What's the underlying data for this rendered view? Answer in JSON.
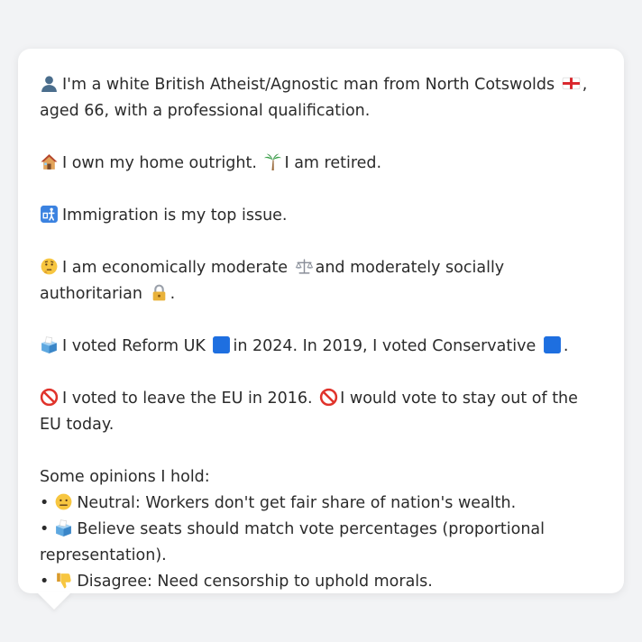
{
  "profile": {
    "intro": {
      "icon": "person-silhouette-icon",
      "text_a": "I'm a white British Atheist/Agnostic man from North Cotswolds",
      "flag_icon": "england-flag-icon",
      "text_b": ", aged 66, with a professional qualification."
    },
    "housing": {
      "icon": "house-icon",
      "text_a": "I own my home outright.",
      "palm_icon": "palm-tree-icon",
      "text_b": "I am retired."
    },
    "issue": {
      "icon": "passport-control-icon",
      "text": "Immigration is my top issue."
    },
    "ideology": {
      "icon": "thinking-face-icon",
      "text_a": "I am economically moderate",
      "scale_icon": "balance-scale-icon",
      "text_b": "and moderately socially authoritarian",
      "lock_icon": "padlock-icon",
      "text_c": "."
    },
    "votes": {
      "icon": "ballot-box-icon",
      "text_a": "I voted Reform UK",
      "reform_icon": "blue-square-icon",
      "text_b": "in 2024. In 2019, I voted Conservative",
      "con_icon": "blue-square-icon",
      "text_c": "."
    },
    "eu": {
      "icon": "prohibited-icon",
      "text_a": "I voted to leave the EU in 2016.",
      "icon_b": "prohibited-icon",
      "text_b": "I would vote to stay out of the EU today."
    },
    "opinions": {
      "heading": "Some opinions I hold:",
      "items": [
        {
          "icon": "neutral-face-icon",
          "text": "Neutral: Workers don't get fair share of nation's wealth."
        },
        {
          "icon": "ballot-box-icon",
          "text": "Believe seats should match vote percentages (proportional representation)."
        },
        {
          "icon": "thumbs-down-icon",
          "text": "Disagree: Need censorship to uphold morals."
        }
      ]
    }
  },
  "colors": {
    "background": "#f2f3f5",
    "bubble": "#ffffff",
    "text": "#2b2b2b",
    "party_blue": "#1e6fe0"
  }
}
